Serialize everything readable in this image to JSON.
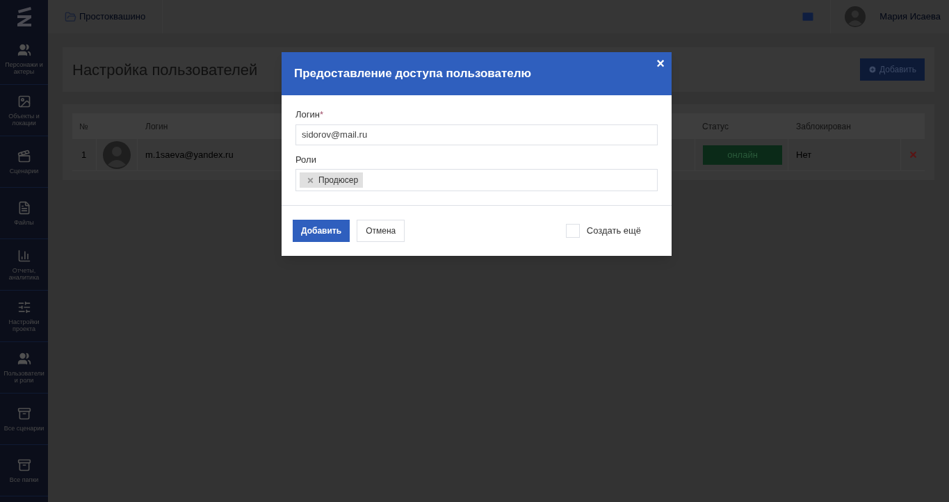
{
  "sidebar": {
    "items": [
      {
        "kind": "people",
        "label": "Персонажи и актеры"
      },
      {
        "kind": "image",
        "label": "Объекты и локации"
      },
      {
        "kind": "clapper",
        "label": "Сценарии"
      },
      {
        "kind": "file",
        "label": "Файлы"
      },
      {
        "kind": "chart",
        "label": "Отчеты, аналитика"
      },
      {
        "kind": "sliders",
        "label": "Настройки проекта"
      },
      {
        "kind": "people",
        "label": "Пользователи и роли"
      },
      {
        "kind": "archive",
        "label": "Все сценарии"
      },
      {
        "kind": "archive",
        "label": "Все папки"
      }
    ]
  },
  "topbar": {
    "project": "Простоквашино",
    "user": "Мария Исаева"
  },
  "page": {
    "title": "Настройка пользователей",
    "add_button": "Добавить"
  },
  "table": {
    "columns": [
      "№",
      "Логин",
      "Статус",
      "Заблокирован"
    ],
    "rows": [
      {
        "number": "1",
        "login": "m.1saeva@yandex.ru",
        "status": "онлайн",
        "blocked": "Нет"
      }
    ]
  },
  "dialog": {
    "title": "Предоставление доступа пользователю",
    "close": "×",
    "login_label": "Логин",
    "required_mark": "*",
    "login_value": "sidorov@mail.ru",
    "roles_label": "Роли",
    "roles": [
      {
        "label": "Продюсер"
      }
    ],
    "submit": "Добавить",
    "cancel": "Отмена",
    "create_more": {
      "label": "Создать ещё",
      "checked": false
    }
  }
}
